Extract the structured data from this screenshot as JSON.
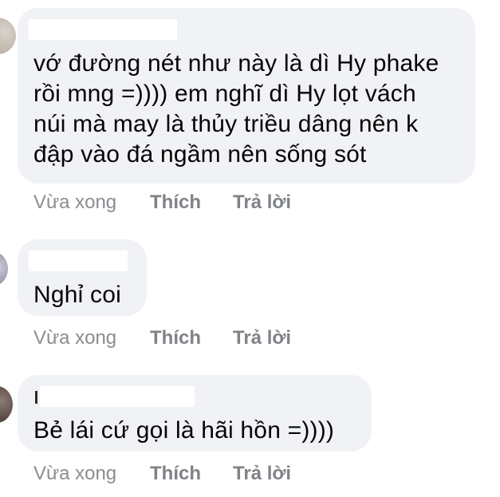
{
  "colors": {
    "bubble": "#f0f2f5",
    "text": "#050505",
    "meta": "#8a8d91"
  },
  "comments": [
    {
      "avatar_icon": "user-avatar-icon",
      "text_lines": [
        "vớ đường nét như này là dì Hy phake",
        "rồi mng =)))) em nghĩ dì Hy lọt vách",
        "núi mà may là thủy triều dâng nên k",
        "đập vào đá ngầm nên sống sót"
      ],
      "time": "Vừa xong",
      "like_label": "Thích",
      "reply_label": "Trả lời"
    },
    {
      "avatar_icon": "user-avatar-icon",
      "text_lines": [
        "Nghỉ coi"
      ],
      "time": "Vừa xong",
      "like_label": "Thích",
      "reply_label": "Trả lời"
    },
    {
      "avatar_icon": "user-avatar-icon",
      "text_lines": [
        "Bẻ lái cứ gọi là hãi hồn =))))"
      ],
      "time": "Vừa xong",
      "like_label": "Thích",
      "reply_label": "Trả lời"
    }
  ]
}
